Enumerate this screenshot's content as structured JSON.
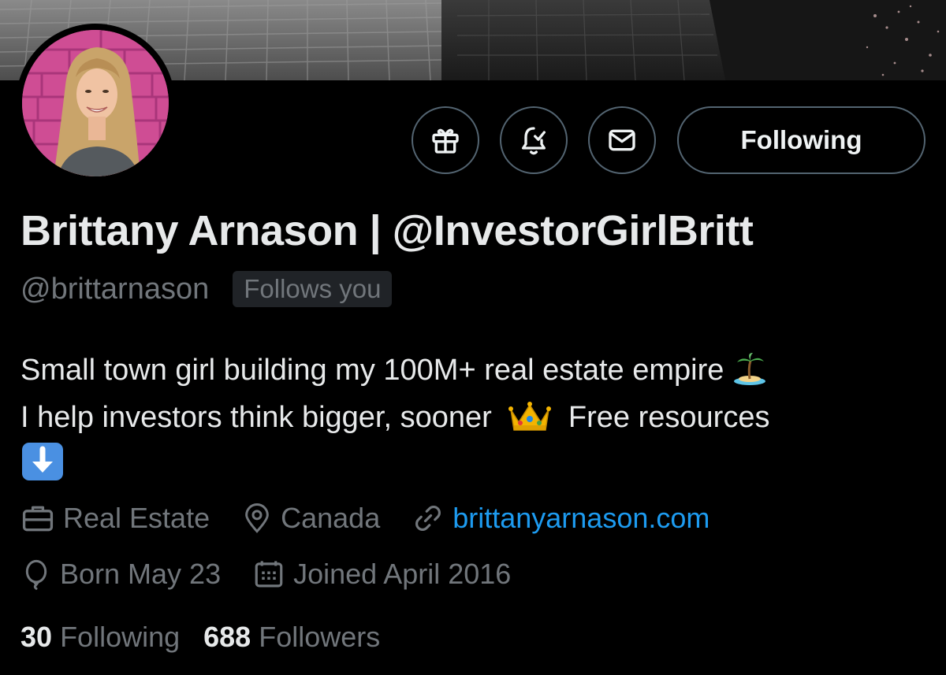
{
  "profile": {
    "display_name": "Brittany Arnason | @InvestorGirlBritt",
    "handle": "@brittarnason",
    "follows_you": "Follows you",
    "bio_line1": "Small town girl building my 100M+ real estate empire",
    "bio_line2a": "I help investors think bigger, sooner",
    "bio_line2b": "Free resources",
    "category": "Real Estate",
    "location": "Canada",
    "website": "brittanyarnason.com",
    "birthday": "Born May 23",
    "joined": "Joined April 2016"
  },
  "actions": {
    "following_label": "Following"
  },
  "stats": {
    "following_count": "30",
    "following_label": "Following",
    "followers_count": "688",
    "followers_label": "Followers"
  },
  "colors": {
    "background": "#000000",
    "text_primary": "#e7e9ea",
    "text_secondary": "#71767b",
    "link": "#1d9bf0",
    "button_border": "#536471"
  },
  "icons": {
    "gift": "gift-icon",
    "notify": "bell-check-icon",
    "message": "envelope-icon",
    "category": "briefcase-icon",
    "location": "location-pin-icon",
    "website": "link-icon",
    "birthday": "balloon-icon",
    "joined": "calendar-icon",
    "bio_emoji_1": "palm-island-emoji",
    "bio_emoji_2": "crown-emoji",
    "bio_emoji_3": "down-arrow-emoji"
  }
}
